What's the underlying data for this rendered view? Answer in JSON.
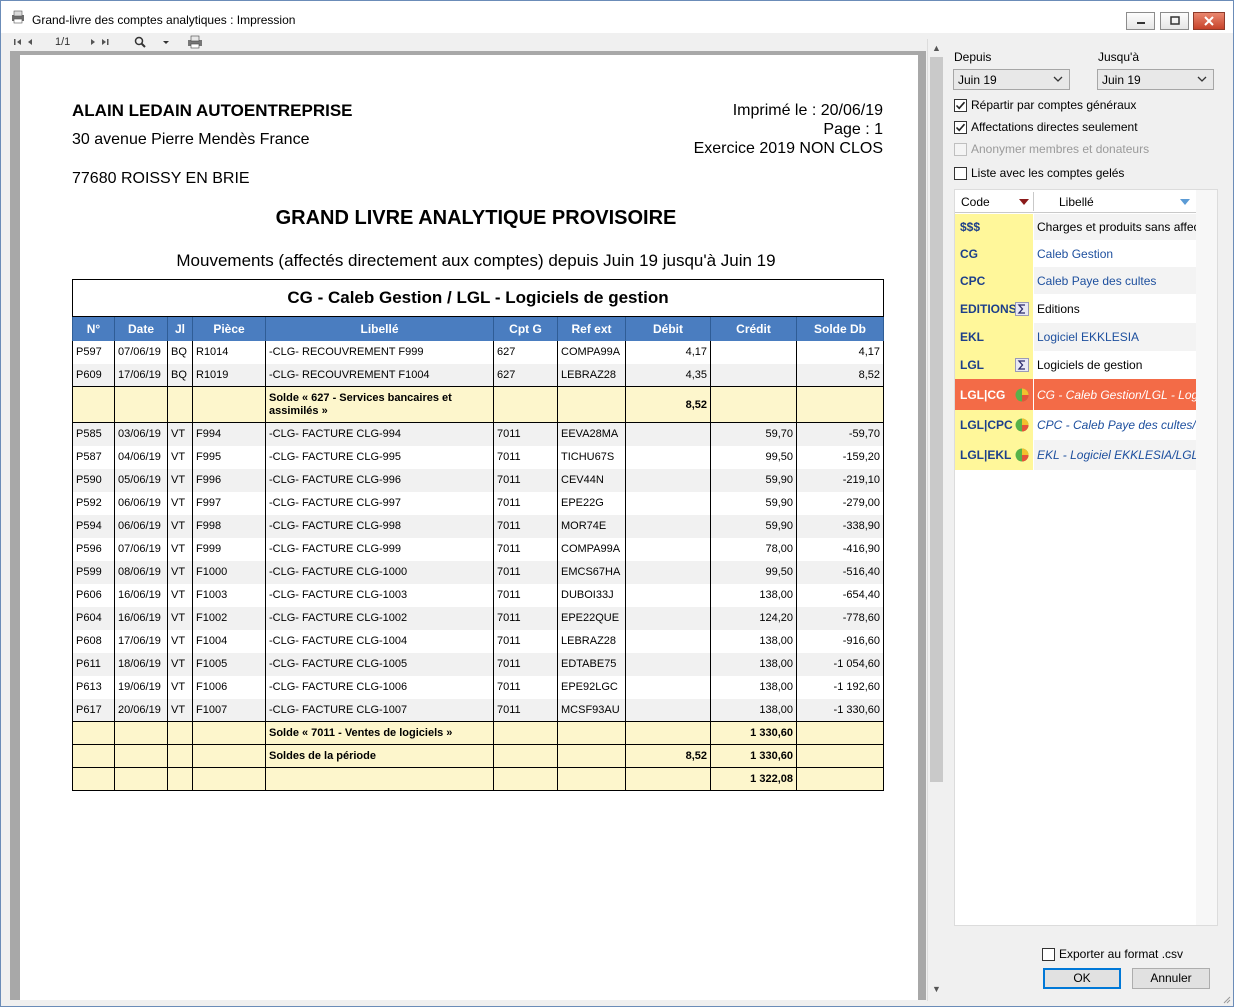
{
  "window": {
    "title": "Grand-livre des comptes analytiques : Impression"
  },
  "toolbar": {
    "page_indicator": "1/1"
  },
  "report": {
    "company": "ALAIN LEDAIN AUTOENTREPRISE",
    "address_line1": "30 avenue Pierre Mendès France",
    "address_line2": "77680 ROISSY EN BRIE",
    "printed": "Imprimé le : 20/06/19",
    "page": "Page : 1",
    "exercise": "Exercice 2019 NON CLOS",
    "title": "GRAND LIVRE ANALYTIQUE PROVISOIRE",
    "subtitle": "Mouvements (affectés directement aux comptes) depuis Juin 19 jusqu'à Juin 19",
    "table_caption": "CG - Caleb Gestion / LGL - Logiciels de gestion",
    "columns": [
      "N°",
      "Date",
      "Jl",
      "Pièce",
      "Libellé",
      "Cpt G",
      "Ref ext",
      "Débit",
      "Crédit",
      "Solde Db"
    ],
    "rows": [
      {
        "n": "P597",
        "date": "07/06/19",
        "jl": "BQ",
        "piece": "R1014",
        "libelle": "-CLG- RECOUVREMENT F999",
        "cptg": "627",
        "ref": "COMPA99A",
        "debit": "4,17",
        "credit": "",
        "solde": "4,17"
      },
      {
        "n": "P609",
        "date": "17/06/19",
        "jl": "BQ",
        "piece": "R1019",
        "libelle": "-CLG- RECOUVREMENT F1004",
        "cptg": "627",
        "ref": "LEBRAZ28",
        "debit": "4,35",
        "credit": "",
        "solde": "8,52"
      },
      {
        "n": "",
        "date": "",
        "jl": "",
        "piece": "",
        "libelle": "Solde « 627 - Services bancaires et assimilés »",
        "cptg": "",
        "ref": "",
        "debit": "8,52",
        "credit": "",
        "solde": "",
        "subtotal": true
      },
      {
        "n": "P585",
        "date": "03/06/19",
        "jl": "VT",
        "piece": "F994",
        "libelle": "-CLG- FACTURE CLG-994",
        "cptg": "7011",
        "ref": "EEVA28MA",
        "debit": "",
        "credit": "59,70",
        "solde": "-59,70"
      },
      {
        "n": "P587",
        "date": "04/06/19",
        "jl": "VT",
        "piece": "F995",
        "libelle": "-CLG- FACTURE CLG-995",
        "cptg": "7011",
        "ref": "TICHU67S",
        "debit": "",
        "credit": "99,50",
        "solde": "-159,20"
      },
      {
        "n": "P590",
        "date": "05/06/19",
        "jl": "VT",
        "piece": "F996",
        "libelle": "-CLG- FACTURE CLG-996",
        "cptg": "7011",
        "ref": "CEV44N",
        "debit": "",
        "credit": "59,90",
        "solde": "-219,10"
      },
      {
        "n": "P592",
        "date": "06/06/19",
        "jl": "VT",
        "piece": "F997",
        "libelle": "-CLG- FACTURE CLG-997",
        "cptg": "7011",
        "ref": "EPE22G",
        "debit": "",
        "credit": "59,90",
        "solde": "-279,00"
      },
      {
        "n": "P594",
        "date": "06/06/19",
        "jl": "VT",
        "piece": "F998",
        "libelle": "-CLG- FACTURE CLG-998",
        "cptg": "7011",
        "ref": "MOR74E",
        "debit": "",
        "credit": "59,90",
        "solde": "-338,90"
      },
      {
        "n": "P596",
        "date": "07/06/19",
        "jl": "VT",
        "piece": "F999",
        "libelle": "-CLG- FACTURE CLG-999",
        "cptg": "7011",
        "ref": "COMPA99A",
        "debit": "",
        "credit": "78,00",
        "solde": "-416,90"
      },
      {
        "n": "P599",
        "date": "08/06/19",
        "jl": "VT",
        "piece": "F1000",
        "libelle": "-CLG- FACTURE CLG-1000",
        "cptg": "7011",
        "ref": "EMCS67HA",
        "debit": "",
        "credit": "99,50",
        "solde": "-516,40"
      },
      {
        "n": "P606",
        "date": "16/06/19",
        "jl": "VT",
        "piece": "F1003",
        "libelle": "-CLG- FACTURE CLG-1003",
        "cptg": "7011",
        "ref": "DUBOI33J",
        "debit": "",
        "credit": "138,00",
        "solde": "-654,40"
      },
      {
        "n": "P604",
        "date": "16/06/19",
        "jl": "VT",
        "piece": "F1002",
        "libelle": "-CLG- FACTURE CLG-1002",
        "cptg": "7011",
        "ref": "EPE22QUE",
        "debit": "",
        "credit": "124,20",
        "solde": "-778,60"
      },
      {
        "n": "P608",
        "date": "17/06/19",
        "jl": "VT",
        "piece": "F1004",
        "libelle": "-CLG- FACTURE CLG-1004",
        "cptg": "7011",
        "ref": "LEBRAZ28",
        "debit": "",
        "credit": "138,00",
        "solde": "-916,60"
      },
      {
        "n": "P611",
        "date": "18/06/19",
        "jl": "VT",
        "piece": "F1005",
        "libelle": "-CLG- FACTURE CLG-1005",
        "cptg": "7011",
        "ref": "EDTABE75",
        "debit": "",
        "credit": "138,00",
        "solde": "-1 054,60"
      },
      {
        "n": "P613",
        "date": "19/06/19",
        "jl": "VT",
        "piece": "F1006",
        "libelle": "-CLG- FACTURE CLG-1006",
        "cptg": "7011",
        "ref": "EPE92LGC",
        "debit": "",
        "credit": "138,00",
        "solde": "-1 192,60"
      },
      {
        "n": "P617",
        "date": "20/06/19",
        "jl": "VT",
        "piece": "F1007",
        "libelle": "-CLG- FACTURE CLG-1007",
        "cptg": "7011",
        "ref": "MCSF93AU",
        "debit": "",
        "credit": "138,00",
        "solde": "-1 330,60"
      },
      {
        "n": "",
        "date": "",
        "jl": "",
        "piece": "",
        "libelle": "Solde « 7011 - Ventes de logiciels »",
        "cptg": "",
        "ref": "",
        "debit": "",
        "credit": "1 330,60",
        "solde": "",
        "subtotal": true
      },
      {
        "n": "",
        "date": "",
        "jl": "",
        "piece": "",
        "libelle": "Soldes de la période",
        "cptg": "",
        "ref": "",
        "debit": "8,52",
        "credit": "1 330,60",
        "solde": "",
        "subtotal": true
      },
      {
        "n": "",
        "date": "",
        "jl": "",
        "piece": "",
        "libelle": "",
        "cptg": "",
        "ref": "",
        "debit": "",
        "credit": "1 322,08",
        "solde": "",
        "subtotal": true
      }
    ]
  },
  "panel": {
    "from_label": "Depuis",
    "to_label": "Jusqu'à",
    "from_value": "Juin 19",
    "to_value": "Juin 19",
    "options": [
      {
        "label": "Répartir par comptes généraux",
        "checked": true,
        "disabled": false
      },
      {
        "label": "Affectations directes seulement",
        "checked": true,
        "disabled": false
      },
      {
        "label": "Anonymer membres et donateurs",
        "checked": false,
        "disabled": true
      },
      {
        "label": "Liste avec les comptes gelés",
        "checked": false,
        "disabled": false
      }
    ],
    "list_header_code": "Code",
    "list_header_label": "Libellé",
    "list_items": [
      {
        "code": "$$$",
        "label": "Charges et produits sans affect",
        "icon": "",
        "style": "normal"
      },
      {
        "code": "CG",
        "label": "Caleb Gestion",
        "icon": "",
        "style": "blue"
      },
      {
        "code": "CPC",
        "label": "Caleb Paye des cultes",
        "icon": "",
        "style": "blue"
      },
      {
        "code": "EDITIONS",
        "label": "Editions",
        "icon": "sigma-icon",
        "style": "normal"
      },
      {
        "code": "EKL",
        "label": "Logiciel EKKLESIA",
        "icon": "",
        "style": "blue"
      },
      {
        "code": "LGL",
        "label": "Logiciels de gestion",
        "icon": "sigma-icon",
        "style": "normal"
      },
      {
        "code": "LGL|CG",
        "label": "CG - Caleb Gestion/LGL - Logiciel",
        "icon": "pie-icon",
        "style": "selected"
      },
      {
        "code": "LGL|CPC",
        "label": "CPC - Caleb Paye des cultes/LGL -",
        "icon": "pie-icon",
        "style": "italic"
      },
      {
        "code": "LGL|EKL",
        "label": "EKL - Logiciel EKKLESIA/LGL - Log",
        "icon": "pie-icon",
        "style": "italic"
      }
    ],
    "export_label": "Exporter au format .csv",
    "ok_label": "OK",
    "cancel_label": "Annuler"
  }
}
